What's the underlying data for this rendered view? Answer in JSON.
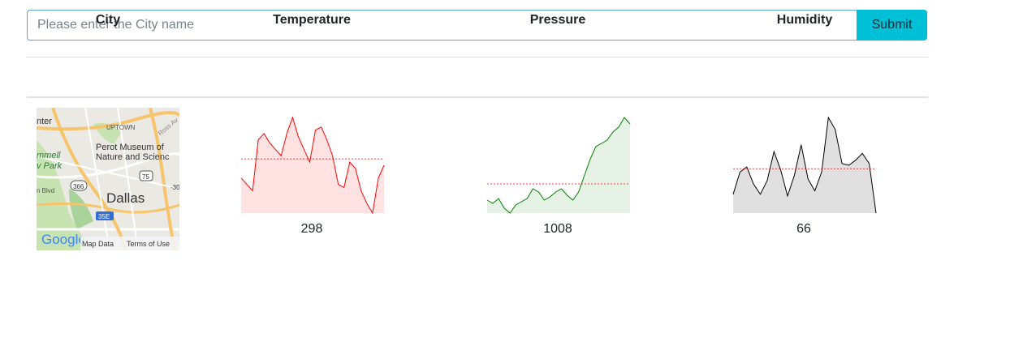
{
  "search": {
    "placeholder": "Please enter the City name",
    "value": "",
    "submit_label": "Submit"
  },
  "table": {
    "headers": [
      "City",
      "Temperature",
      "Pressure",
      "Humidity"
    ],
    "rows": [
      {
        "map": {
          "labels": [
            "nter",
            "UPTOWN",
            "Ross Av",
            "Perot Museum of",
            "Nature and Scienc",
            "mmell",
            "v Park",
            "75",
            "366",
            "n Blvd",
            "Dallas",
            "-30",
            "35E",
            "Google",
            "Map Data",
            "Terms of Use"
          ]
        },
        "temperature": {
          "value": "298",
          "color": "#ff0000",
          "fill": "#ffe3e3",
          "series": [
            298.1,
            297.9,
            297.7,
            299.3,
            299.5,
            299.2,
            299.0,
            298.8,
            299.5,
            300.0,
            299.4,
            299.0,
            298.6,
            299.6,
            299.7,
            299.3,
            298.8,
            297.9,
            297.8,
            298.6,
            298.4,
            297.7,
            297.3,
            297.0,
            298.1,
            298.5
          ],
          "mean": 298.7
        },
        "pressure": {
          "value": "1008",
          "color": "#008000",
          "fill": "#e5f2e5",
          "series": [
            1006.3,
            1006.1,
            1006.4,
            1005.8,
            1005.5,
            1006.0,
            1006.2,
            1006.4,
            1007.0,
            1006.8,
            1006.3,
            1006.5,
            1006.8,
            1007.0,
            1006.6,
            1006.3,
            1006.8,
            1007.8,
            1008.8,
            1009.6,
            1009.8,
            1010.0,
            1010.5,
            1010.8,
            1011.4,
            1011.0
          ],
          "mean": 1007.3
        },
        "humidity": {
          "value": "66",
          "color": "#000000",
          "fill": "#e0e0e0",
          "series": [
            55,
            68,
            71,
            61,
            55,
            63,
            80,
            69,
            54,
            66,
            84,
            64,
            57,
            68,
            100,
            93,
            73,
            72,
            75,
            79,
            73,
            44
          ],
          "mean": 70
        }
      }
    ]
  }
}
